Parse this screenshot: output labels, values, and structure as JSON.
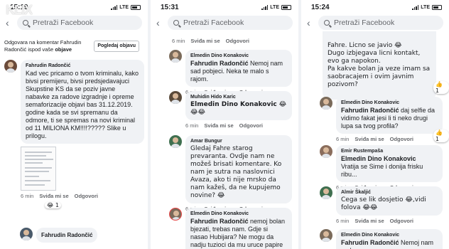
{
  "watermark": "KLIX",
  "status_bars": [
    {
      "time": "15:19",
      "network": "LTE"
    },
    {
      "time": "15:31",
      "network": "LTE"
    },
    {
      "time": "15:24",
      "network": "LTE"
    }
  ],
  "search": {
    "placeholder": "Pretraži Facebook"
  },
  "panel1": {
    "reply_info": "Odgovara na komentar Fahrudin Radončić ispod vaše",
    "reply_info_bold": "objave",
    "view_post_button": "Pogledaj objavu",
    "comment": {
      "author": "Fahrudin Radončić",
      "text": "Kad vec pricamo o tvom kriminalu, kako bivsi premijeru, bivsi predsjedavajuci Skupstine KS da se poziv javne nabavke za radove izgradnje i opreme semaforizacije objavi bas 31.12.2019. godine kada se svi spremanu da odmore, ti se spremas na novi kriminal od 11 MILIONA KM!!!!?????  Slike u prilogu.",
      "time": "6 min",
      "like": "Sviđa mi se",
      "reply": "Odgovori",
      "reaction": "😂 1"
    },
    "next_author": "Fahrudin Radončić"
  },
  "panel2": {
    "top_meta": {
      "time": "6 min",
      "like": "Sviđa mi se",
      "reply": "Odgovori"
    },
    "comments": [
      {
        "author": "Elmedin Dino Konakovic",
        "mention": "Fahrudin Radončić",
        "text": " Nemoj nam sad pobjeci. Neka te malo s rajom.",
        "time": "6 min",
        "like": "Sviđa mi se",
        "reply": "Odgovori"
      },
      {
        "author": "Muhidin Hido Karic",
        "mention": "Elmedin Dino Konakovic",
        "text": " 😂😂😂",
        "time": "6 min",
        "like": "Sviđa mi se",
        "reply": "Odgovori"
      },
      {
        "author": "Amar Bungur",
        "mention": "",
        "text": "Gledaj Fahre starog prevaranta. Ovdje nam ne možeš brisati komentare. Ko nam je sutra na naslovnici Avaza, ako ti nije mrsko da nam kažeš, da ne kupujemo novine? 😂",
        "time": "6 min",
        "like": "Sviđa mi se",
        "reply": "Odgovori"
      },
      {
        "author": "Elmedin Dino Konakovic",
        "mention": "Fahrudin Radončić",
        "text": " nemoj bolan bjezati, trebas nam. Gdje si nasao Hubijara? Ne mogu da nadju tuzioci da mu uruce papire neke, gdje si ga",
        "time": "",
        "like": "",
        "reply": ""
      }
    ]
  },
  "panel3": {
    "top_text": "Fahre. Licno se javio 😂\nDugo izbjegava licni kontakt, evo ga napokon.\nPa kakve bolan ja veze imam sa saobracajem i ovim javnim pozivom?",
    "top_reaction": "👍 1",
    "comments": [
      {
        "author": "Elmedin Dino Konakovic",
        "mention": "Fahrudin Radončić",
        "text": " daj selfie da vidimo fakat jesi li ti neko drugi lupa sa tvog profila?",
        "time": "6 min",
        "like": "Sviđa mi se",
        "reply": "Odgovori",
        "reaction": "👍 1"
      },
      {
        "author": "Emir Rustempaša",
        "mention": "Elmedin Dino Konakovic",
        "text": "Vratija se Sime i donija frisku ribu...",
        "time": "6 min",
        "like": "Sviđa mi se",
        "reply": "Odgovori"
      },
      {
        "author": "Almir Škaljić",
        "mention": "",
        "text": "Cega se lik dosjetio 😂,vidi folova 😂😂",
        "time": "6 min",
        "like": "Sviđa mi se",
        "reply": "Odgovori"
      },
      {
        "author": "Elmedin Dino Konakovic",
        "mention": "Fahrudin Radončić",
        "text": " Nemoj nam sad",
        "time": "",
        "like": "",
        "reply": ""
      }
    ]
  }
}
